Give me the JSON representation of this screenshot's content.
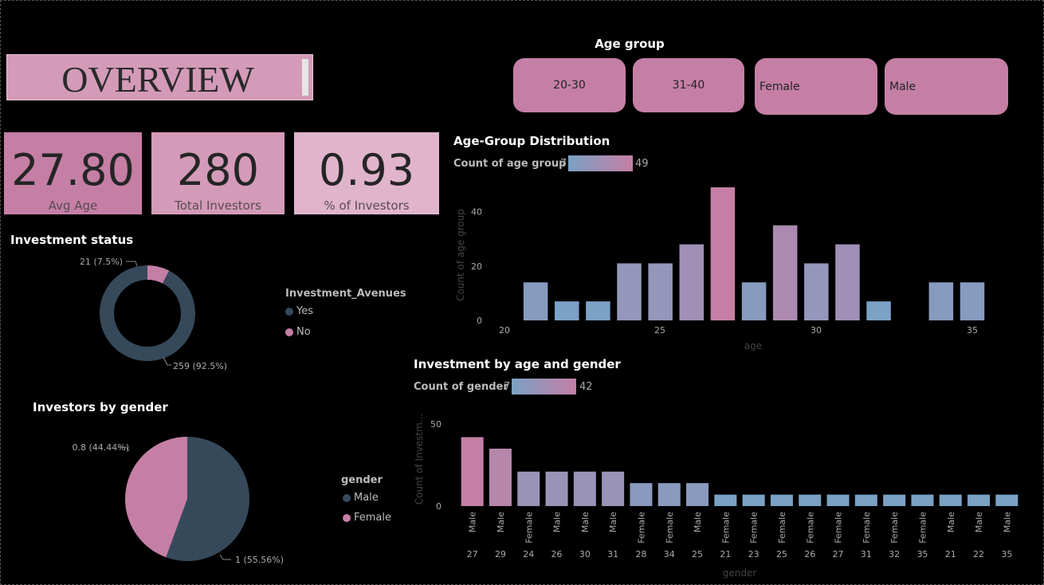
{
  "title": "OVERVIEW",
  "slicer": {
    "title": "Age group",
    "options": [
      "20-30",
      "31-40",
      "Female",
      "Male"
    ]
  },
  "kpis": [
    {
      "value": "27.80",
      "label": "Avg Age"
    },
    {
      "value": "280",
      "label": "Total Investors"
    },
    {
      "value": "0.93",
      "label": "% of Investors"
    }
  ],
  "colors": {
    "accent": "#c57fa5",
    "dark": "#36495a",
    "blue": "#7ba1c4",
    "pink": "#c57fa5"
  },
  "chart_data": [
    {
      "id": "investment_status",
      "type": "pie",
      "donut": true,
      "title": "Investment status",
      "legend_title": "Investment_Avenues",
      "legend_position": "right",
      "slices": [
        {
          "name": "Yes",
          "value": 259,
          "label": "259 (92.5%)",
          "color": "#36495a"
        },
        {
          "name": "No",
          "value": 21,
          "label": "21 (7.5%)",
          "color": "#c57fa5"
        }
      ]
    },
    {
      "id": "investors_by_gender",
      "type": "pie",
      "donut": false,
      "title": "Investors by gender",
      "legend_title": "gender",
      "legend_position": "right",
      "slices": [
        {
          "name": "Male",
          "value": 1,
          "label": "1 (55.56%)",
          "color": "#36495a"
        },
        {
          "name": "Female",
          "value": 0.8,
          "label": "0.8 (44.44%)",
          "color": "#c57fa5"
        }
      ]
    },
    {
      "id": "age_group_distribution",
      "type": "bar",
      "title": "Age-Group Distribution",
      "legend_title": "Count of age group",
      "color_min": 7,
      "color_max": 49,
      "xlabel": "age",
      "ylabel": "Count of age group",
      "xlim": [
        20,
        35
      ],
      "ylim": [
        0,
        49
      ],
      "xticks": [
        20,
        25,
        30,
        35
      ],
      "yticks": [
        0,
        20,
        40
      ],
      "x": [
        21,
        22,
        23,
        24,
        25,
        26,
        27,
        28,
        29,
        30,
        31,
        32,
        34,
        35
      ],
      "values": [
        14,
        7,
        7,
        21,
        21,
        28,
        49,
        14,
        35,
        21,
        28,
        7,
        14,
        14
      ]
    },
    {
      "id": "investment_by_age_gender",
      "type": "bar",
      "title": "Investment by age and gender",
      "legend_title": "Count of gender",
      "color_min": 7,
      "color_max": 42,
      "xlabel": "gender",
      "ylabel": "Count of Investm...",
      "ylim": [
        0,
        50
      ],
      "yticks": [
        0,
        50
      ],
      "categories": [
        {
          "gender": "Male",
          "age": "27"
        },
        {
          "gender": "Male",
          "age": "29"
        },
        {
          "gender": "Female",
          "age": "24"
        },
        {
          "gender": "Male",
          "age": "26"
        },
        {
          "gender": "Male",
          "age": "30"
        },
        {
          "gender": "Male",
          "age": "31"
        },
        {
          "gender": "Female",
          "age": "28"
        },
        {
          "gender": "Female",
          "age": "34"
        },
        {
          "gender": "Male",
          "age": "25"
        },
        {
          "gender": "Female",
          "age": "21"
        },
        {
          "gender": "Female",
          "age": "23"
        },
        {
          "gender": "Female",
          "age": "25"
        },
        {
          "gender": "Female",
          "age": "26"
        },
        {
          "gender": "Female",
          "age": "27"
        },
        {
          "gender": "Female",
          "age": "31"
        },
        {
          "gender": "Female",
          "age": "32"
        },
        {
          "gender": "Female",
          "age": "35"
        },
        {
          "gender": "Male",
          "age": "21"
        },
        {
          "gender": "Male",
          "age": "22"
        },
        {
          "gender": "Male",
          "age": "35"
        }
      ],
      "values": [
        42,
        35,
        21,
        21,
        21,
        21,
        14,
        14,
        14,
        7,
        7,
        7,
        7,
        7,
        7,
        7,
        7,
        7,
        7,
        7
      ]
    }
  ]
}
